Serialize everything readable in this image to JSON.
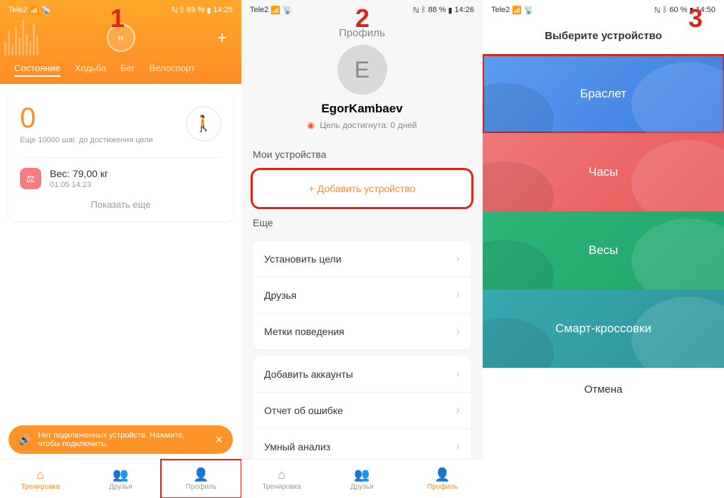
{
  "phone1": {
    "statusbar": {
      "carrier": "Tele2",
      "battery": "89 %",
      "time": "14:25"
    },
    "step_number": "1",
    "tabs": [
      "Состояние",
      "Ходьба",
      "Бег",
      "Велоспорт"
    ],
    "steps": {
      "count": "0",
      "subtitle": "Еще 10000 шаг. до достижения цели"
    },
    "weight": {
      "label": "Вес: 79,00 кг",
      "date": "01.05 14:23"
    },
    "show_more": "Показать еще",
    "snackbar": {
      "text": "Нет подключенных устройств. Нажмите, чтобы подключить."
    },
    "nav": {
      "workout": "Тренировка",
      "friends": "Друзья",
      "profile": "Профиль"
    }
  },
  "phone2": {
    "statusbar": {
      "carrier": "Tele2",
      "battery": "88 %",
      "time": "14:26"
    },
    "step_number": "2",
    "title": "Профиль",
    "avatar_letter": "E",
    "username": "EgorKambaev",
    "goal_text": "Цель достигнута: 0 дней",
    "section_devices": "Мои устройства",
    "add_device": "Добавить устройство",
    "section_more": "Еще",
    "menu1": [
      "Установить цели",
      "Друзья",
      "Метки поведения"
    ],
    "menu2": [
      "Добавить аккаунты",
      "Отчет об ошибке",
      "Умный анализ"
    ],
    "nav": {
      "workout": "Тренировка",
      "friends": "Друзья",
      "profile": "Профиль"
    }
  },
  "phone3": {
    "statusbar": {
      "carrier": "Tele2",
      "battery": "60 %",
      "time": "14:50"
    },
    "step_number": "3",
    "title": "Выберите устройство",
    "devices": {
      "bracelet": "Браслет",
      "watch": "Часы",
      "scale": "Весы",
      "shoes": "Смарт-кроссовки"
    },
    "cancel": "Отмена"
  }
}
